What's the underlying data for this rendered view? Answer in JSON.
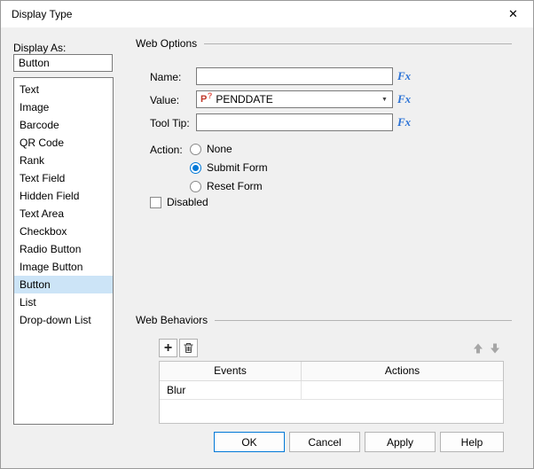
{
  "window": {
    "title": "Display Type"
  },
  "icons": {
    "close": "✕",
    "dropdown_arrow": "▼",
    "param_letter": "P",
    "param_question": "?",
    "plus": "+",
    "trash": "trash-can",
    "move_up": "up-arrow",
    "move_down": "down-arrow"
  },
  "display_as": {
    "label": "Display As:",
    "value": "Button",
    "items": [
      "Text",
      "Image",
      "Barcode",
      "QR Code",
      "Rank",
      "Text Field",
      "Hidden Field",
      "Text Area",
      "Checkbox",
      "Radio Button",
      "Image Button",
      "Button",
      "List",
      "Drop-down List"
    ],
    "selected_index": 11
  },
  "web_options": {
    "group_label": "Web Options",
    "fx_label": "Fx",
    "name": {
      "label": "Name:",
      "value": ""
    },
    "value": {
      "label": "Value:",
      "value": "PENDDATE"
    },
    "tooltip": {
      "label": "Tool Tip:",
      "value": ""
    },
    "action": {
      "label": "Action:",
      "options": [
        {
          "label": "None",
          "selected": false
        },
        {
          "label": "Submit Form",
          "selected": true
        },
        {
          "label": "Reset Form",
          "selected": false
        }
      ]
    },
    "disabled": {
      "label": "Disabled",
      "checked": false
    }
  },
  "web_behaviors": {
    "group_label": "Web Behaviors",
    "table": {
      "headers": [
        "Events",
        "Actions"
      ],
      "rows": [
        [
          "Blur",
          ""
        ]
      ]
    }
  },
  "footer": {
    "ok": "OK",
    "cancel": "Cancel",
    "apply": "Apply",
    "help": "Help"
  },
  "colors": {
    "accent": "#0078d7",
    "selection": "#cce4f7"
  }
}
